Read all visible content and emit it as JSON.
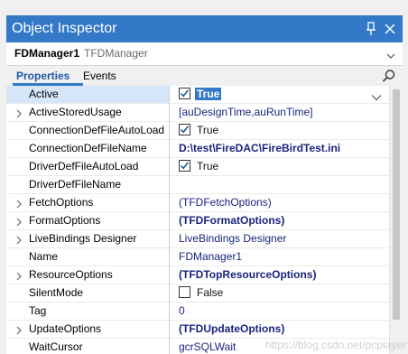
{
  "window": {
    "title": "Object Inspector",
    "pin_icon": "pin-icon",
    "close_icon": "close-icon"
  },
  "selector": {
    "component_name": "FDManager1",
    "component_type": "TFDManager"
  },
  "tabs": {
    "properties": "Properties",
    "events": "Events"
  },
  "properties": [
    {
      "name": "Active",
      "value": "True",
      "expandable": false,
      "checkbox": true,
      "checked": true,
      "bold": true,
      "selected": true
    },
    {
      "name": "ActiveStoredUsage",
      "value": "[auDesignTime,auRunTime]",
      "expandable": true,
      "bold": false
    },
    {
      "name": "ConnectionDefFileAutoLoad",
      "value": "True",
      "expandable": false,
      "checkbox": true,
      "checked": true,
      "bold": false
    },
    {
      "name": "ConnectionDefFileName",
      "value": "D:\\test\\FireDAC\\FireBirdTest.ini",
      "expandable": false,
      "bold": true
    },
    {
      "name": "DriverDefFileAutoLoad",
      "value": "True",
      "expandable": false,
      "checkbox": true,
      "checked": true,
      "bold": false
    },
    {
      "name": "DriverDefFileName",
      "value": "",
      "expandable": false,
      "bold": false
    },
    {
      "name": "FetchOptions",
      "value": "(TFDFetchOptions)",
      "expandable": true,
      "bold": false
    },
    {
      "name": "FormatOptions",
      "value": "(TFDFormatOptions)",
      "expandable": true,
      "bold": true
    },
    {
      "name": "LiveBindings Designer",
      "value": "LiveBindings Designer",
      "expandable": true,
      "bold": false
    },
    {
      "name": "Name",
      "value": "FDManager1",
      "expandable": false,
      "bold": false
    },
    {
      "name": "ResourceOptions",
      "value": "(TFDTopResourceOptions)",
      "expandable": true,
      "bold": true
    },
    {
      "name": "SilentMode",
      "value": "False",
      "expandable": false,
      "checkbox": true,
      "checked": false,
      "bold": false
    },
    {
      "name": "Tag",
      "value": "0",
      "expandable": false,
      "bold": false
    },
    {
      "name": "UpdateOptions",
      "value": "(TFDUpdateOptions)",
      "expandable": true,
      "bold": true
    },
    {
      "name": "WaitCursor",
      "value": "gcrSQLWait",
      "expandable": false,
      "bold": false
    }
  ],
  "watermark": "https://blog.csdn.net/pcplayer",
  "colors": {
    "titlebar": "#3379c7",
    "selected_row": "#d5e6f8",
    "value_text": "#1a237e"
  }
}
